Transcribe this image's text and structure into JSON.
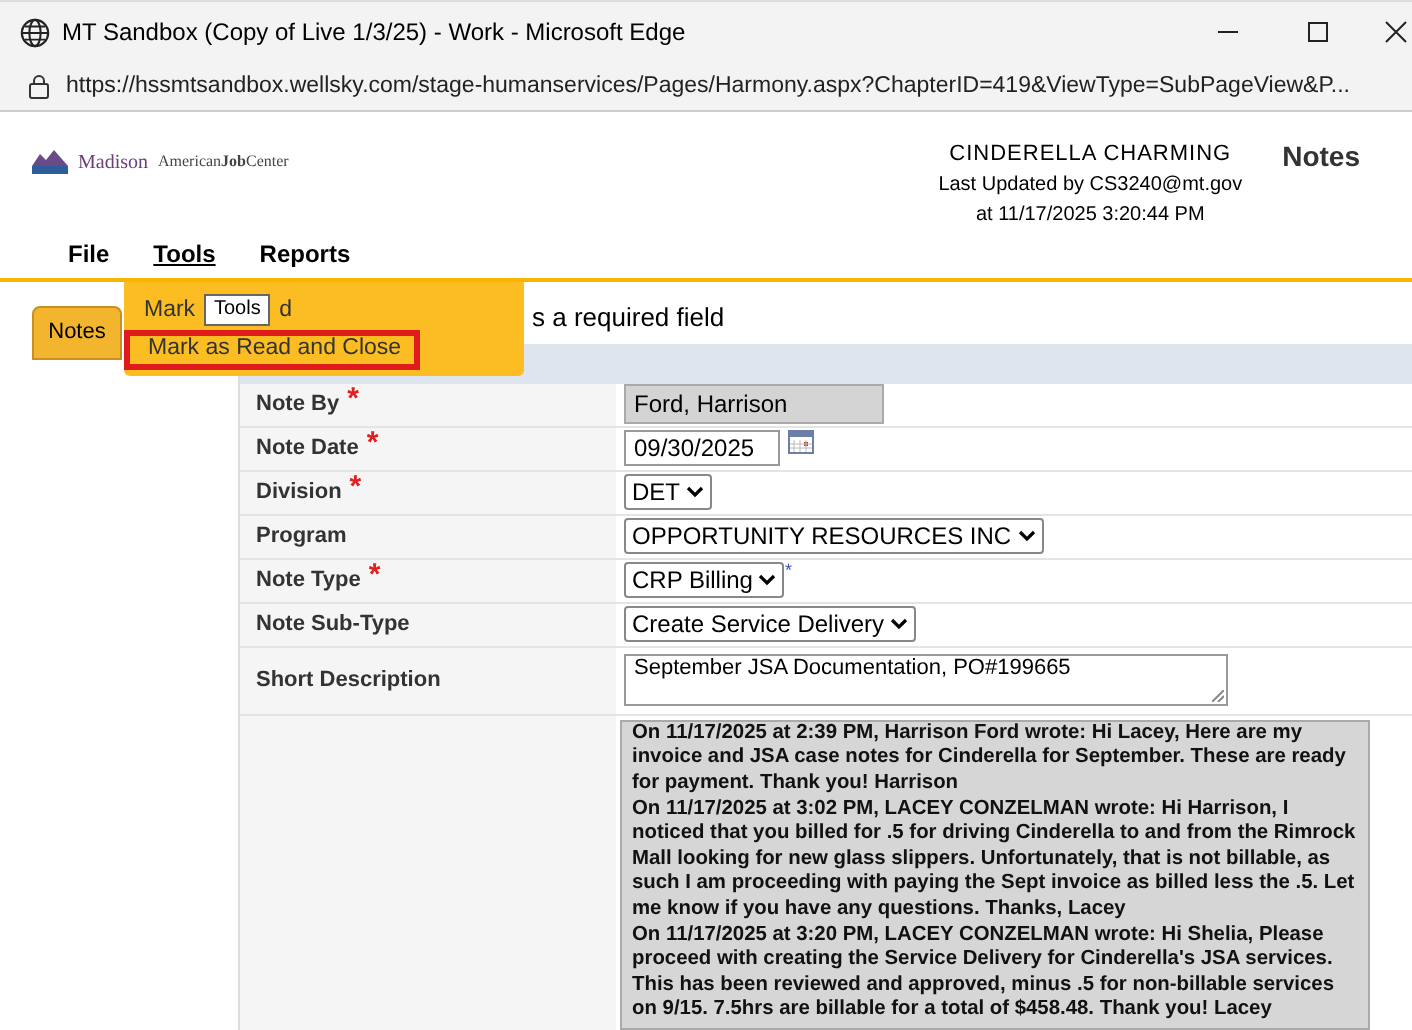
{
  "window": {
    "title": "MT Sandbox (Copy of Live 1/3/25) - Work - Microsoft Edge",
    "url": "https://hssmtsandbox.wellsky.com/stage-humanservices/Pages/Harmony.aspx?ChapterID=419&ViewType=SubPageView&P..."
  },
  "header": {
    "logo_text": "Madison",
    "logo_text_2": "American",
    "logo_text_3": "Job",
    "logo_text_4": "Center",
    "client": "CINDERELLA CHARMING",
    "updated_by": "Last Updated by CS3240@mt.gov",
    "updated_at": "at 11/17/2025 3:20:44 PM",
    "page_title": "Notes"
  },
  "menu": [
    {
      "label": "File",
      "selected": false
    },
    {
      "label": "Tools",
      "selected": true
    },
    {
      "label": "Reports",
      "selected": false
    }
  ],
  "dropdown": {
    "items": [
      {
        "parts": [
          "Mark",
          "d"
        ],
        "highlighted": false
      },
      {
        "parts": [
          "Mark as Read and Close"
        ],
        "highlighted": true
      }
    ],
    "tooltip": "Tools"
  },
  "side_tabs": [
    {
      "label": "Notes",
      "selected": true
    }
  ],
  "heading": "s a required field",
  "form": [
    {
      "label": "Note By",
      "required": true,
      "kind": "readonly",
      "value": "Ford, Harrison"
    },
    {
      "label": "Note Date",
      "required": true,
      "kind": "date",
      "value": "09/30/2025"
    },
    {
      "label": "Division",
      "required": true,
      "kind": "select",
      "value": "DET"
    },
    {
      "label": "Program",
      "required": false,
      "kind": "select",
      "value": "OPPORTUNITY RESOURCES INC"
    },
    {
      "label": "Note Type",
      "required": true,
      "kind": "select",
      "value": "CRP Billing",
      "suffix": "*"
    },
    {
      "label": "Note Sub-Type",
      "required": false,
      "kind": "select",
      "value": "Create Service Delivery"
    },
    {
      "label": "Short Description",
      "required": false,
      "kind": "textarea",
      "value": "September JSA Documentation, PO#199665"
    }
  ],
  "notes": [
    "On 11/17/2025 at 2:39 PM,  Harrison Ford wrote: Hi Lacey, Here are my invoice and JSA case notes for Cinderella for September. These are ready for payment. Thank you! Harrison",
    "On 11/17/2025 at 3:02 PM,  LACEY CONZELMAN wrote: Hi Harrison, I noticed that you billed for .5 for driving Cinderella to and from the Rimrock Mall looking for new glass slippers. Unfortunately, that is not billable, as such I am proceeding with paying the Sept invoice as billed less the .5. Let me know if you have any questions. Thanks, Lacey",
    "On 11/17/2025 at 3:20 PM,  LACEY CONZELMAN wrote: Hi Shelia, Please proceed with creating the Service Delivery for Cinderella's JSA services. This has been reviewed and approved, minus .5 for non-billable services on 9/15. 7.5hrs are billable for a total of $458.48. Thank you! Lacey"
  ]
}
